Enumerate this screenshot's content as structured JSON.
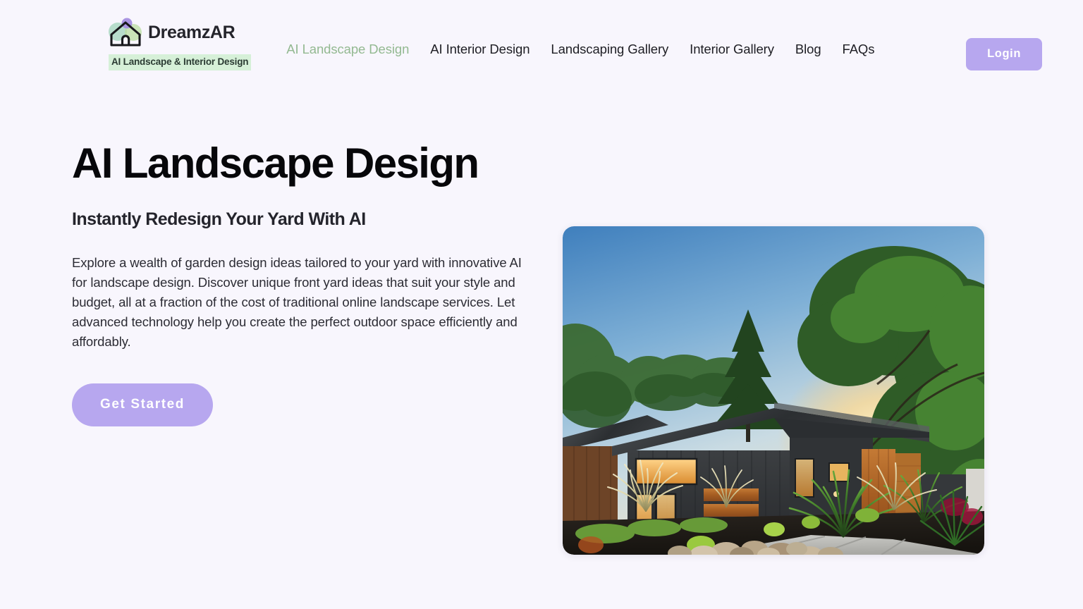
{
  "theme": {
    "page_background": "#f8f6fd",
    "accent_purple": "#b7a7ef",
    "accent_green": "#93b991",
    "tagline_highlight": "#d6f0d8",
    "text_dark": "#1e1e24"
  },
  "header": {
    "logo": {
      "icon": "house-logo-icon",
      "brand_name": "DreamzAR",
      "tagline": "AI Landscape & Interior Design"
    },
    "nav": [
      {
        "label": "AI Landscape Design",
        "active": true
      },
      {
        "label": "AI Interior Design",
        "active": false
      },
      {
        "label": "Landscaping Gallery",
        "active": false
      },
      {
        "label": "Interior Gallery",
        "active": false
      },
      {
        "label": "Blog",
        "active": false
      },
      {
        "label": "FAQs",
        "active": false
      }
    ],
    "login_label": "Login"
  },
  "hero": {
    "title": "AI Landscape Design",
    "subtitle": "Instantly Redesign Your Yard With AI",
    "paragraph": "Explore a wealth of garden design ideas tailored to your yard with innovative AI for landscape design. Discover unique front yard ideas that suit your style and budget, all at a fraction of the cost of traditional online landscape services. Let advanced technology help you create the perfect outdoor space efficiently and affordably.",
    "cta_label": "Get Started",
    "image": {
      "alt": "Modern dark-siding single story house at sunset with wood accents, concrete walkway, ornamental grasses, black mulch beds and river rock border",
      "name": "hero-landscape-photo"
    }
  }
}
